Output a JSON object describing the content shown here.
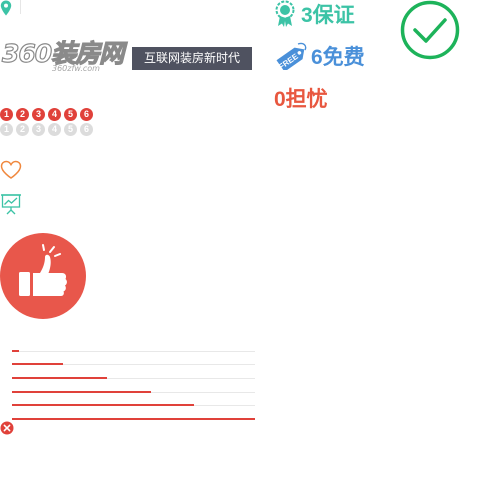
{
  "icons": {
    "pin": "map-pin-icon",
    "award": "award-ribbon-icon",
    "tag": "price-tag-icon",
    "check": "check-circle-icon",
    "heart": "heart-icon",
    "chart": "presentation-chart-icon",
    "thumb": "thumbs-up-icon",
    "close": "close-circle-icon"
  },
  "logo": {
    "main": "360装房网",
    "sub": "360zfw.com"
  },
  "slogan": "互联网装房新时代",
  "tag_icon_text": "FREE",
  "features": [
    {
      "label": "3保证",
      "color": "#3cc3a6"
    },
    {
      "label": "6免费",
      "color": "#4a90d9"
    },
    {
      "label": "0担忧",
      "color": "#e8573f"
    }
  ],
  "badges_red": [
    "1",
    "2",
    "3",
    "4",
    "5",
    "6"
  ],
  "badges_gray": [
    "1",
    "2",
    "3",
    "4",
    "5",
    "6"
  ],
  "progress_levels": [
    0.03,
    0.21,
    0.39,
    0.57,
    0.75,
    1.0
  ],
  "colors": {
    "accent_red": "#e0413a",
    "thumb_bg": "#e8574b",
    "teal": "#3cc3a6",
    "blue": "#4a90d9",
    "check_green": "#1db35a",
    "slogan_bg": "#4f5260"
  }
}
